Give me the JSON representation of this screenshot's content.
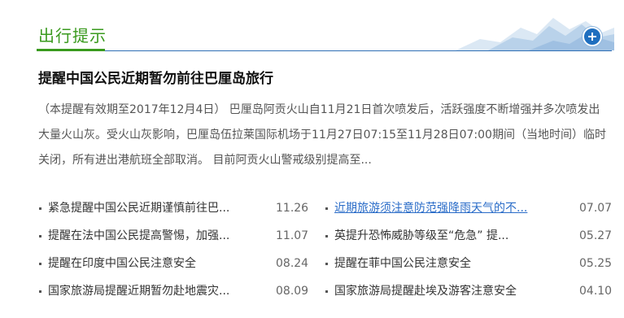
{
  "header": {
    "title": "出行提示"
  },
  "headline": "提醒中国公民近期暂勿前往巴厘岛旅行",
  "summary": "（本提醒有效期至2017年12月4日） 巴厘岛阿贡火山自11月21日首次喷发后，活跃强度不断增强并多次喷发出大量火山灰。受火山灰影响，巴厘岛伍拉莱国际机场于11月27日07:15至11月28日07:00期间（当地时间）临时关闭，所有进出港航班全部取消。 目前阿贡火山警戒级别提高至...",
  "news_left": [
    {
      "title": "紧急提醒中国公民近期谨慎前往巴...",
      "date": "11.26"
    },
    {
      "title": "提醒在法中国公民提高警惕，加强...",
      "date": "11.07"
    },
    {
      "title": "提醒在印度中国公民注意安全",
      "date": "08.24"
    },
    {
      "title": "国家旅游局提醒近期暂勿赴地震灾...",
      "date": "08.09"
    }
  ],
  "news_right": [
    {
      "title": "近期旅游须注意防范强降雨天气的不...",
      "date": "07.07"
    },
    {
      "title": "英提升恐怖威胁等级至“危急” 提...",
      "date": "05.27"
    },
    {
      "title": "提醒在菲中国公民注意安全",
      "date": "05.25"
    },
    {
      "title": "国家旅游局提醒赴埃及游客注意安全",
      "date": "04.10"
    }
  ],
  "colors": {
    "accent_green": "#3a9a1e",
    "accent_blue": "#2f6fb5",
    "link_blue": "#2a6cc8"
  }
}
